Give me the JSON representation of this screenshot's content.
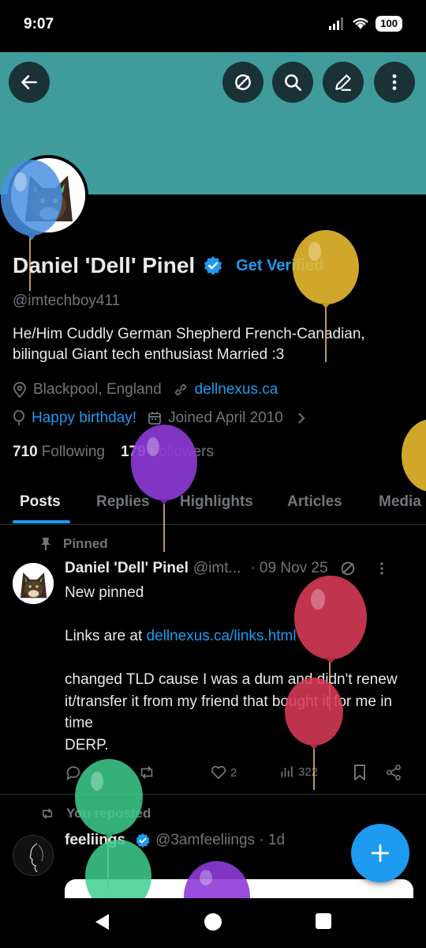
{
  "status_bar": {
    "time": "9:07",
    "battery": "100"
  },
  "profile": {
    "display_name": "Daniel 'Dell' Pinel",
    "get_verified": "Get Verified",
    "handle": "@imtechboy411",
    "bio": "He/Him Cuddly German Shepherd French-Canadian, bilingual Giant tech enthusiast Married :3",
    "location": "Blackpool, England",
    "website": "dellnexus.ca",
    "birthday": "Happy birthday!",
    "joined": "Joined April 2010",
    "following_count": "710",
    "following_label": "Following",
    "followers_count": "179",
    "followers_label": "Followers"
  },
  "tabs": [
    {
      "label": "Posts"
    },
    {
      "label": "Replies"
    },
    {
      "label": "Highlights"
    },
    {
      "label": "Articles"
    },
    {
      "label": "Media"
    }
  ],
  "pinned_post": {
    "pinned_label": "Pinned",
    "author": "Daniel 'Dell' Pinel",
    "handle": "@imt...",
    "date": "· 09 Nov 25",
    "line1": "New pinned",
    "line2_prefix": "Links are at ",
    "line2_link": "dellnexus.ca/links.html",
    "line3": "changed TLD cause I was a dum and didn't renew it/transfer it from my friend that bought it for me in time",
    "line4": "DERP.",
    "likes": "2",
    "views": "322"
  },
  "repost": {
    "label": "You reposted",
    "author": "feeliings",
    "handle_date": "@3amfeeliings · 1d"
  },
  "colors": {
    "banner": "#3f9c9b",
    "accent": "#1d9bf0",
    "muted": "#71767b",
    "balloon_colors": [
      "#4a90e2",
      "#e8b930",
      "#8e3bd8",
      "#d63a55",
      "#3ecf8e"
    ]
  }
}
